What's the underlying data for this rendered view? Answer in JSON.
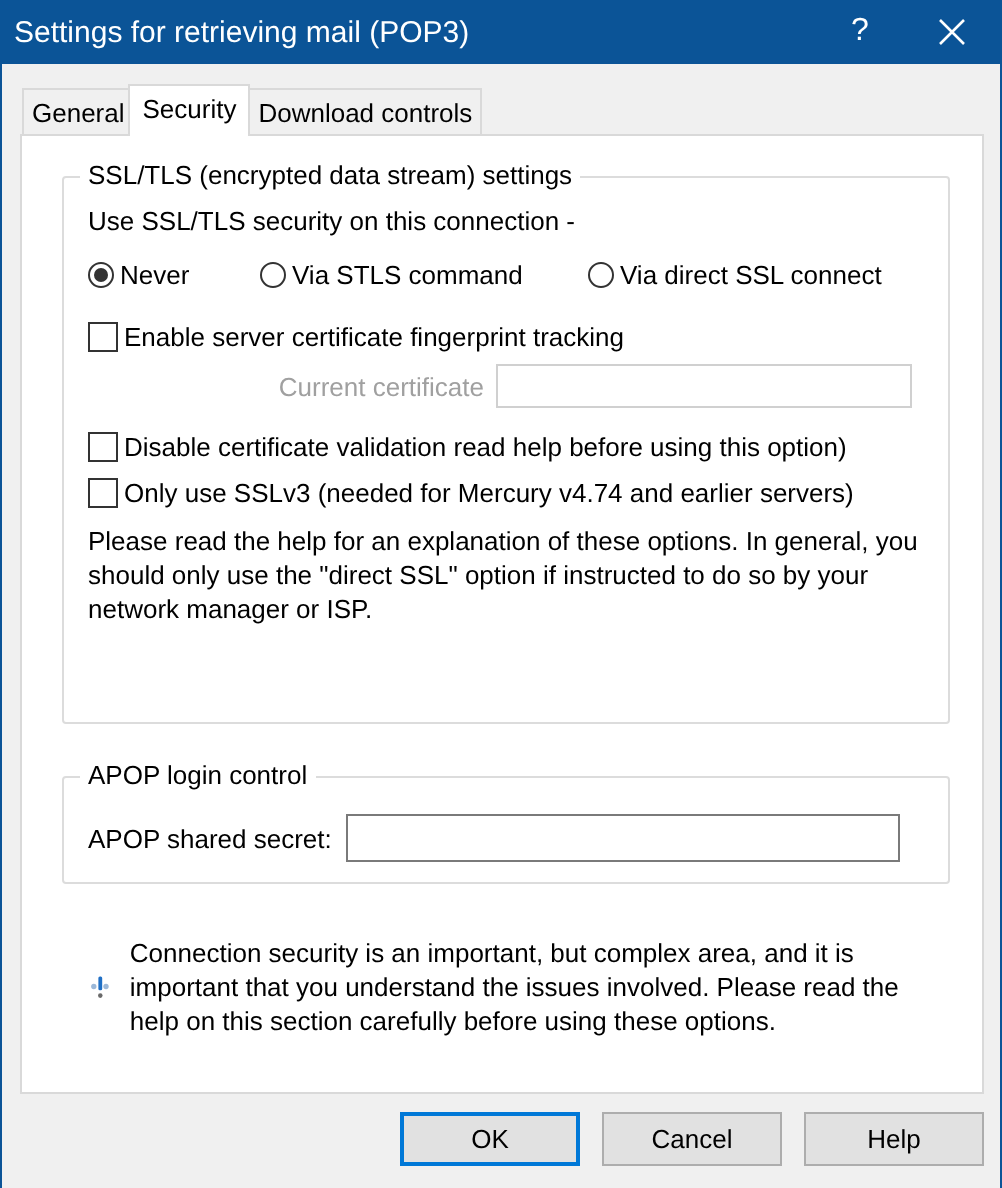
{
  "window": {
    "title": "Settings for retrieving mail (POP3)",
    "help_button": "?"
  },
  "tabs": [
    {
      "label": "General",
      "selected": false
    },
    {
      "label": "Security",
      "selected": true
    },
    {
      "label": "Download controls",
      "selected": false
    }
  ],
  "ssl_group": {
    "title": "SSL/TLS (encrypted data stream) settings",
    "prompt": "Use SSL/TLS security on this connection -",
    "options": [
      {
        "label": "Never",
        "selected": true
      },
      {
        "label": "Via STLS command",
        "selected": false
      },
      {
        "label": "Via direct SSL connect",
        "selected": false
      }
    ],
    "fingerprint": {
      "label": "Enable server certificate fingerprint tracking",
      "checked": false
    },
    "certificate": {
      "label": "Current certificate",
      "disabled": true
    },
    "checkboxes": [
      {
        "label": "Disable certificate validation read help before using this option)",
        "checked": false
      },
      {
        "label": "Only use SSLv3 (needed for Mercury v4.74 and earlier servers)",
        "checked": false
      }
    ],
    "note": "Please read the help for an explanation of these options. In general, you should only use the \"direct SSL\" option if instructed to do so by your network manager or ISP."
  },
  "apop_group": {
    "title": "APOP login control",
    "label": "APOP shared secret:"
  },
  "info": {
    "text": "Connection security is an important, but complex area, and it is important that you understand the issues involved. Please read the help on this section carefully before using these options."
  },
  "buttons": [
    {
      "label": "OK",
      "default": true
    },
    {
      "label": "Cancel",
      "default": false
    },
    {
      "label": "Help",
      "default": false
    }
  ]
}
